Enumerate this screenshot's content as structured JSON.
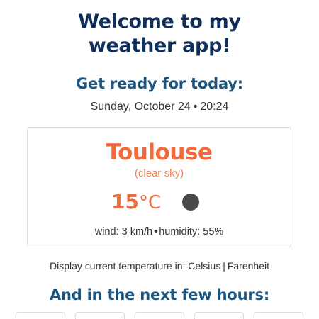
{
  "app": {
    "title_line1": "Welcome to my",
    "title_line2": "weather app!"
  },
  "today": {
    "heading": "Get ready for today:",
    "day": "Sunday, October 24",
    "separator": "•",
    "time": "20:24"
  },
  "current": {
    "city": "Toulouse",
    "condition": "(clear sky)",
    "temperature": "15",
    "unit": "°C",
    "icon": "clear-night-icon",
    "wind_label": "wind: 3 km/h",
    "separator": "•",
    "humidity_label": "humidity: 55%"
  },
  "unit_toggle": {
    "prefix": "Display current temperature in:",
    "celsius": "Celsius",
    "separator": "|",
    "fahrenheit": "Farenheit"
  },
  "forecast": {
    "heading": "And in the next few hours:",
    "card_count": 5
  },
  "colors": {
    "title": "#0f2e5a",
    "heading": "#1c5680",
    "accent": "#f26b3a",
    "icon": "#4a4a4a"
  }
}
